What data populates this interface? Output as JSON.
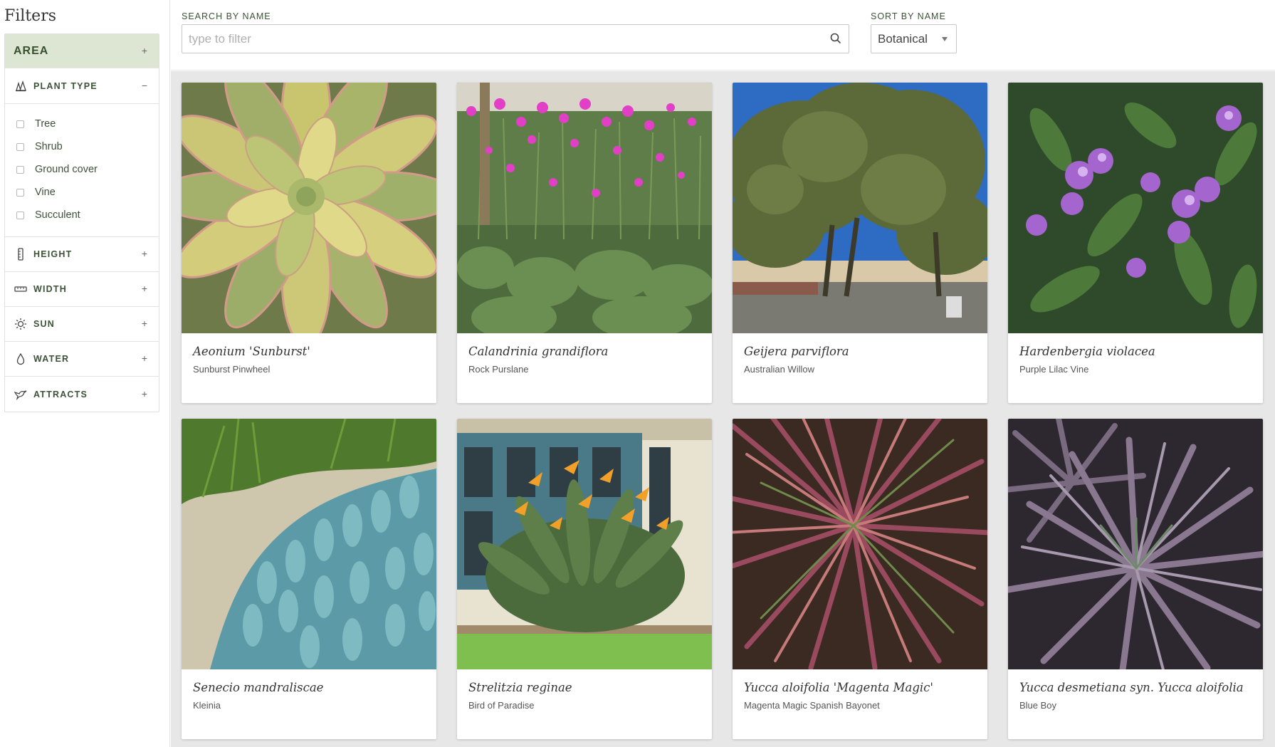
{
  "sidebar": {
    "title": "Filters",
    "area_label": "AREA",
    "plant_type_label": "PLANT TYPE",
    "plant_types": [
      "Tree",
      "Shrub",
      "Ground cover",
      "Vine",
      "Succulent"
    ],
    "height_label": "HEIGHT",
    "width_label": "WIDTH",
    "sun_label": "SUN",
    "water_label": "WATER",
    "attracts_label": "ATTRACTS",
    "toggle_plus": "+",
    "toggle_minus": "−"
  },
  "search": {
    "label": "SEARCH BY NAME",
    "placeholder": "type to filter",
    "value": ""
  },
  "sort": {
    "label": "SORT BY NAME",
    "selected": "Botanical"
  },
  "plants": [
    {
      "botanical": "Aeonium 'Sunburst'",
      "common": "Sunburst Pinwheel"
    },
    {
      "botanical": "Calandrinia grandiflora",
      "common": "Rock Purslane"
    },
    {
      "botanical": "Geijera parviflora",
      "common": "Australian Willow"
    },
    {
      "botanical": "Hardenbergia violacea",
      "common": "Purple Lilac Vine"
    },
    {
      "botanical": "Senecio mandraliscae",
      "common": "Kleinia"
    },
    {
      "botanical": "Strelitzia reginae",
      "common": "Bird of Paradise"
    },
    {
      "botanical": "Yucca aloifolia 'Magenta Magic'",
      "common": "Magenta Magic Spanish Bayonet"
    },
    {
      "botanical": "Yucca desmetiana syn. Yucca aloifolia",
      "common": "Blue Boy"
    }
  ],
  "colors": {
    "accent_green": "#3c5238",
    "area_bg": "#dde6d2",
    "grid_bg": "#e7e7e7"
  }
}
